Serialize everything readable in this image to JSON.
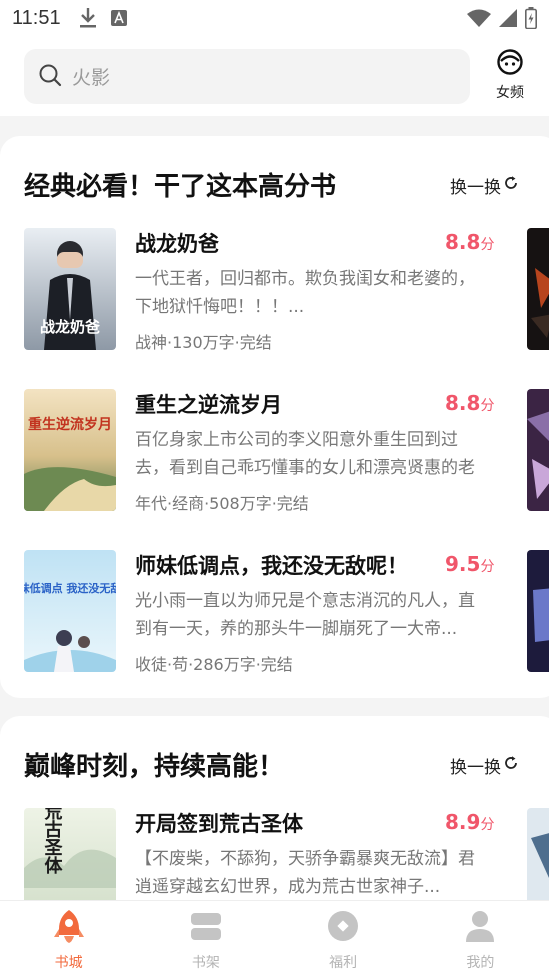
{
  "status_bar": {
    "time": "11:51"
  },
  "header": {
    "search_placeholder": "火影",
    "gender_label": "女频"
  },
  "sections": [
    {
      "title": "经典必看！干了这本高分书",
      "refresh_label": "换一换",
      "books": [
        {
          "title": "战龙奶爸",
          "score": "8.8",
          "unit": "分",
          "desc": "一代王者，回归都市。欺负我闺女和老婆的，下地狱忏悔吧！！！...",
          "meta": "战神·130万字·完结",
          "cover_text": "战龙奶爸"
        },
        {
          "title": "重生之逆流岁月",
          "score": "8.8",
          "unit": "分",
          "desc": "百亿身家上市公司的李义阳意外重生回到过去，看到自己乖巧懂事的女儿和漂亮贤惠的老婆...",
          "meta": "年代·经商·508万字·完结",
          "cover_text": "重生逆流岁月"
        },
        {
          "title": "师妹低调点，我还没无敌呢！",
          "score": "9.5",
          "unit": "分",
          "desc": "光小雨一直以为师兄是个意志消沉的凡人，直到有一天，养的那头牛一脚崩死了一大帝...",
          "meta": "收徒·苟·286万字·完结",
          "cover_text": "师妹低调点 我还没无敌呢"
        }
      ]
    },
    {
      "title": "巅峰时刻，持续高能！",
      "refresh_label": "换一换",
      "books": [
        {
          "title": "开局签到荒古圣体",
          "score": "8.9",
          "unit": "分",
          "desc": "【不废柴，不舔狗，天骄争霸暴爽无敌流】君逍遥穿越玄幻世界，成为荒古世家神子...",
          "meta": "",
          "cover_text": "荒古圣体"
        }
      ]
    }
  ],
  "tabs": [
    {
      "label": "书城",
      "icon": "rocket-icon",
      "active": true
    },
    {
      "label": "书架",
      "icon": "bookshelf-icon",
      "active": false
    },
    {
      "label": "福利",
      "icon": "gift-icon",
      "active": false
    },
    {
      "label": "我的",
      "icon": "user-icon",
      "active": false
    }
  ],
  "colors": {
    "accent": "#f0566a",
    "tab_active": "#f26a3d",
    "tab_inactive": "#b4b4b4"
  }
}
